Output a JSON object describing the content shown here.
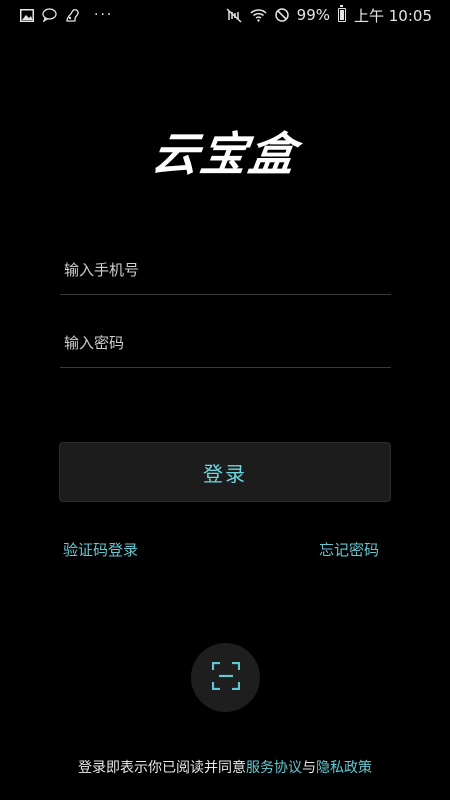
{
  "status_bar": {
    "left_icons": [
      "image-icon",
      "chat-bubble-icon",
      "squirrel-icon",
      "more-dots-icon"
    ],
    "more": "···",
    "battery_percent": "99%",
    "time": "上午 10:05",
    "right_icons": [
      "mute-icon",
      "wifi-icon",
      "do-not-disturb-icon",
      "battery-icon"
    ]
  },
  "app": {
    "logo_text": "云宝盒"
  },
  "form": {
    "phone_placeholder": "输入手机号",
    "phone_value": "",
    "password_placeholder": "输入密码",
    "password_value": "",
    "login_label": "登录"
  },
  "links": {
    "sms_login": "验证码登录",
    "forgot_password": "忘记密码"
  },
  "scan": {
    "icon": "scan-icon"
  },
  "footer": {
    "prefix": "登录即表示你已阅读并同意",
    "terms": "服务协议",
    "conjunction": "与",
    "privacy": "隐私政策"
  },
  "colors": {
    "background": "#000000",
    "accent": "#63c8d2",
    "button_bg": "#1c1c1c",
    "divider": "#3a3a3a"
  }
}
